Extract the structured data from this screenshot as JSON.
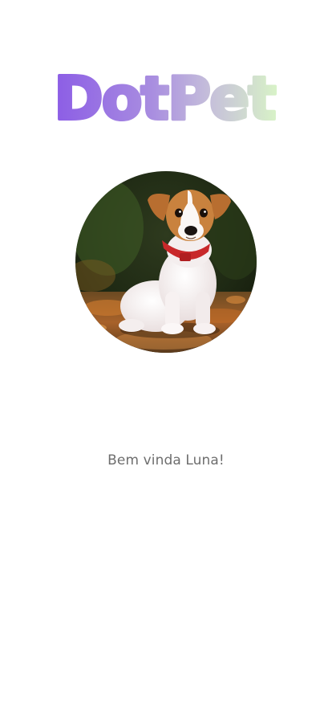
{
  "app": {
    "logo_text": "DotPet"
  },
  "profile": {
    "photo_icon": "dog-photo"
  },
  "welcome": {
    "message": "Bem vinda Luna!"
  },
  "colors": {
    "logo_gradient_start": "#8f5fe8",
    "logo_gradient_mid": "#b59ee0",
    "logo_gradient_end": "#d8f3c8",
    "welcome_text": "#6e6e6e"
  }
}
